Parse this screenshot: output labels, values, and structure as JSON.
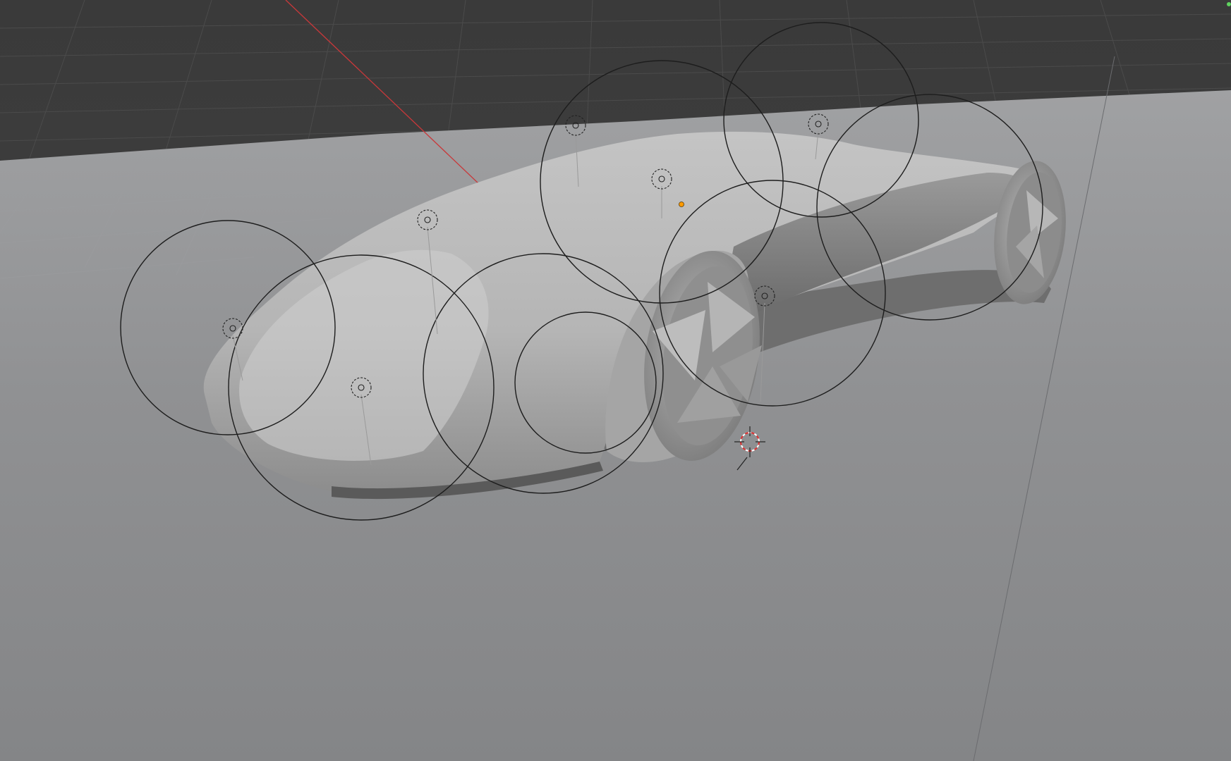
{
  "viewport": {
    "mode": "3d-viewport-solid-shading",
    "colors": {
      "background_top": "#3b3b3b",
      "background_grid_line": "#484848",
      "floor_plane": "#8a8b8d",
      "floor_plane_light": "#a2a3a5",
      "car_body_light": "#c9c9c9",
      "car_body_mid": "#a9a9a9",
      "car_body_dark": "#6f6f6f",
      "x_axis": "#c8383a",
      "light_gizmo": "#1d1d1d",
      "selection_origin": "#ff9a00",
      "cursor_red": "#e03030",
      "corner_indicator": "#5fd35f"
    }
  },
  "scene": {
    "objects": [
      {
        "name": "car-body",
        "icon": "mesh-object"
      },
      {
        "name": "light-area",
        "icon": "light-icon",
        "count": 8
      },
      {
        "name": "3d-cursor",
        "icon": "cursor-icon"
      }
    ]
  }
}
